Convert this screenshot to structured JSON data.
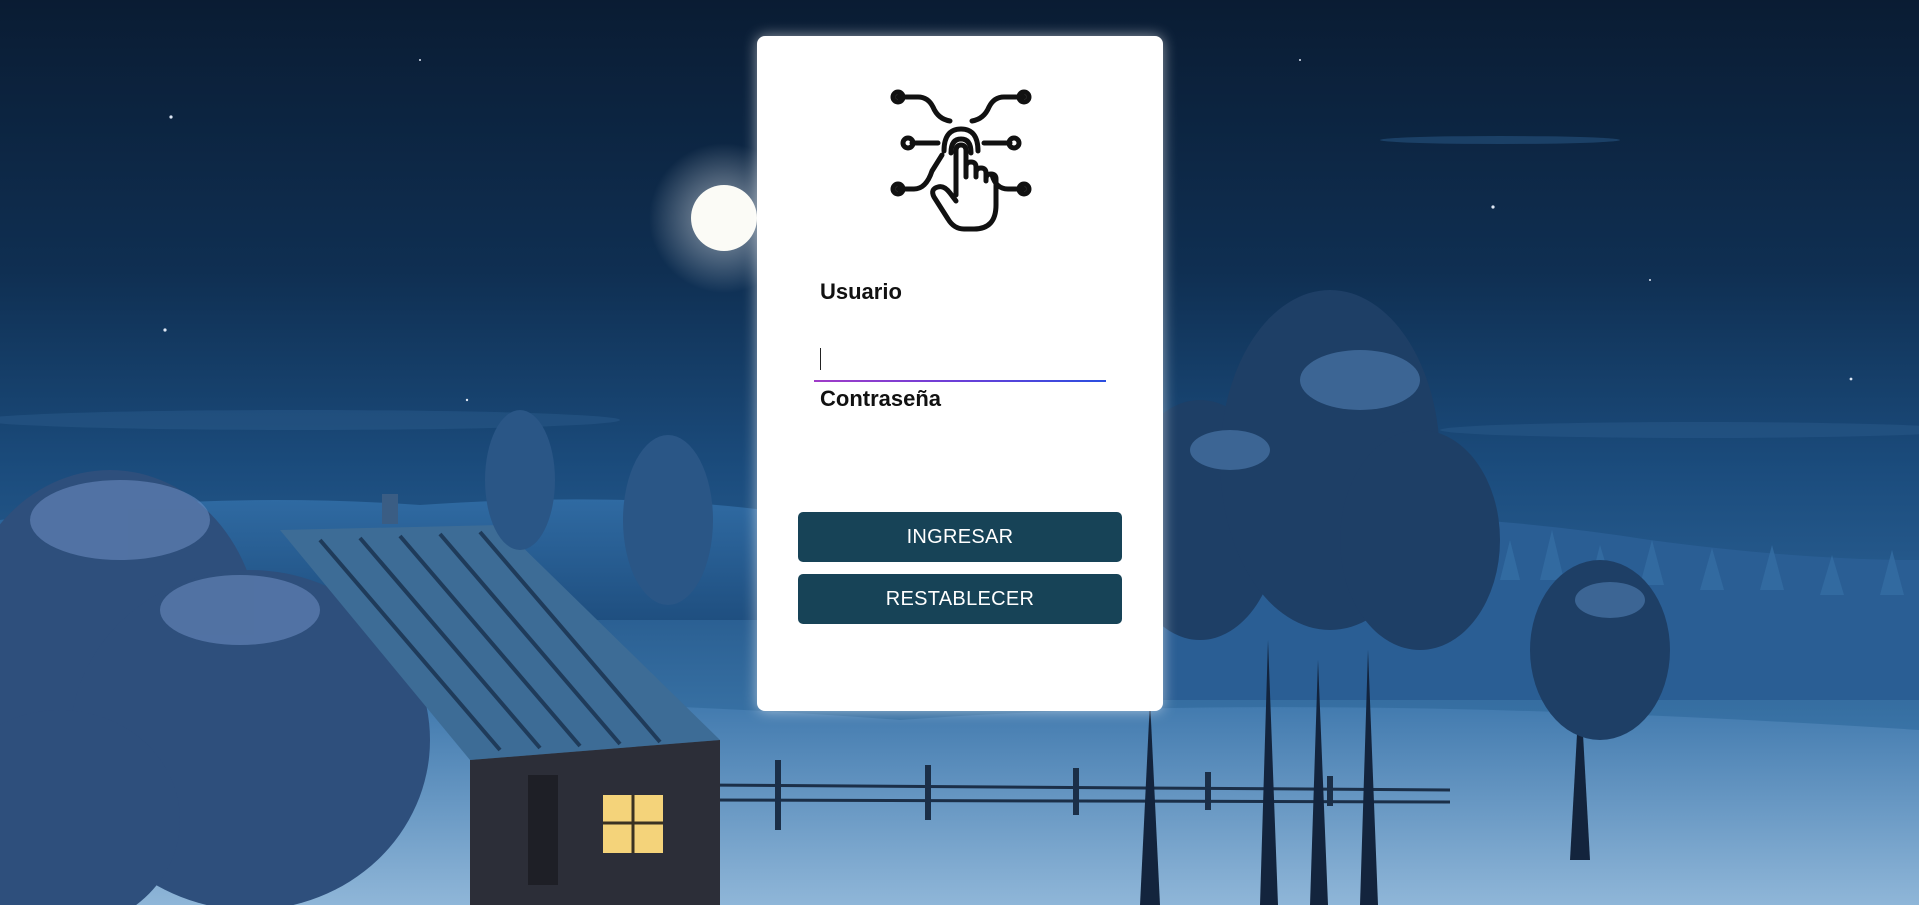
{
  "login": {
    "logo_icon": "touch-circuit-icon",
    "username_label": "Usuario",
    "username_value": "",
    "password_label": "Contraseña",
    "password_value": "",
    "login_button": "INGRESAR",
    "reset_button": "RESTABLECER"
  },
  "colors": {
    "button_bg": "#174357",
    "card_bg": "#ffffff",
    "underline_start": "#a03cc8",
    "underline_end": "#2a4ee0"
  }
}
